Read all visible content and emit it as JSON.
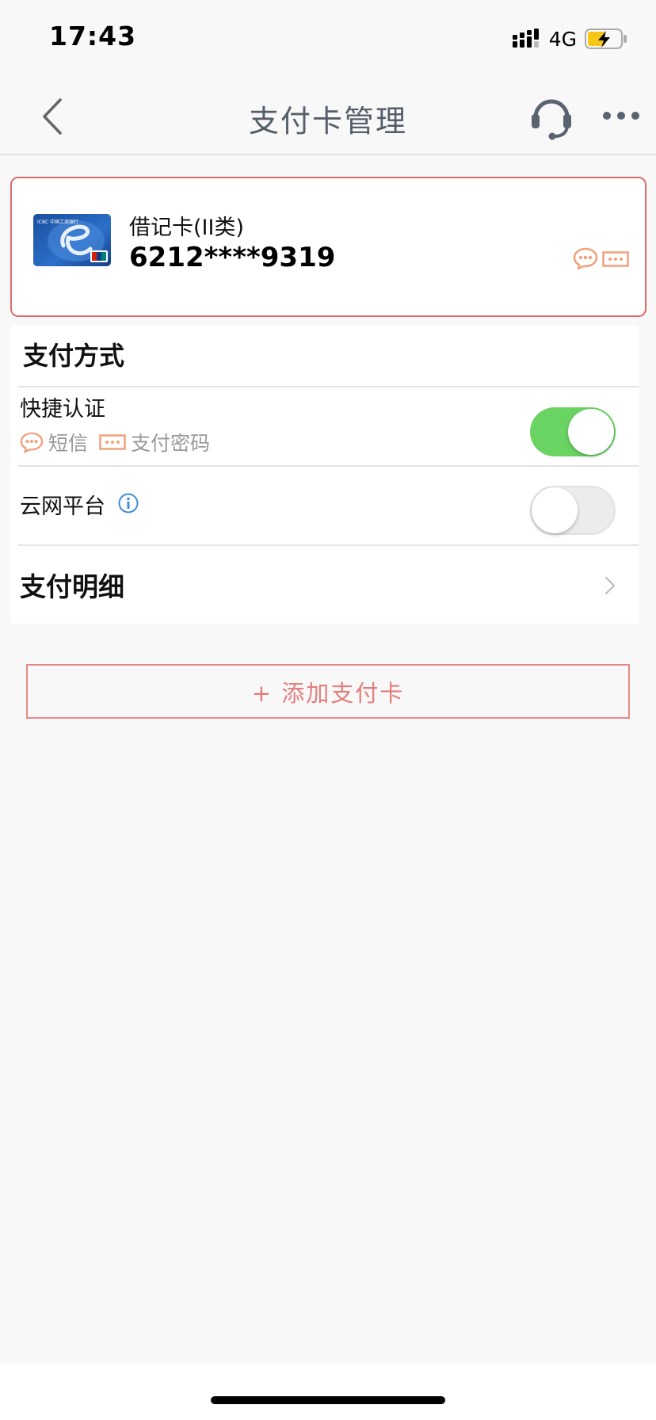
{
  "status_bar": {
    "time": "17:43",
    "network": "4G",
    "icons": [
      "signal-icon",
      "battery-charging-icon"
    ]
  },
  "nav": {
    "title": "支付卡管理",
    "icons": [
      "back-chevron-icon",
      "headset-icon",
      "more-icon"
    ]
  },
  "card": {
    "type_label": "借记卡(II类)",
    "number": "6212****9319",
    "bank_logo_text": "ICBC 中国工商银行",
    "icons": [
      "sms-icon",
      "password-icon"
    ]
  },
  "payment_method": {
    "title": "支付方式",
    "quick_auth": {
      "label": "快捷认证",
      "sms_label": "短信",
      "password_label": "支付密码",
      "enabled": true
    },
    "cloud_platform": {
      "label": "云网平台",
      "enabled": false
    }
  },
  "payment_detail": {
    "label": "支付明细"
  },
  "add_card": {
    "label": "+ 添加支付卡"
  },
  "colors": {
    "accent_red": "#e06a6a",
    "toggle_on": "#6ad463",
    "icon_orange": "#f2a07c",
    "info_blue": "#3d8fd6"
  }
}
